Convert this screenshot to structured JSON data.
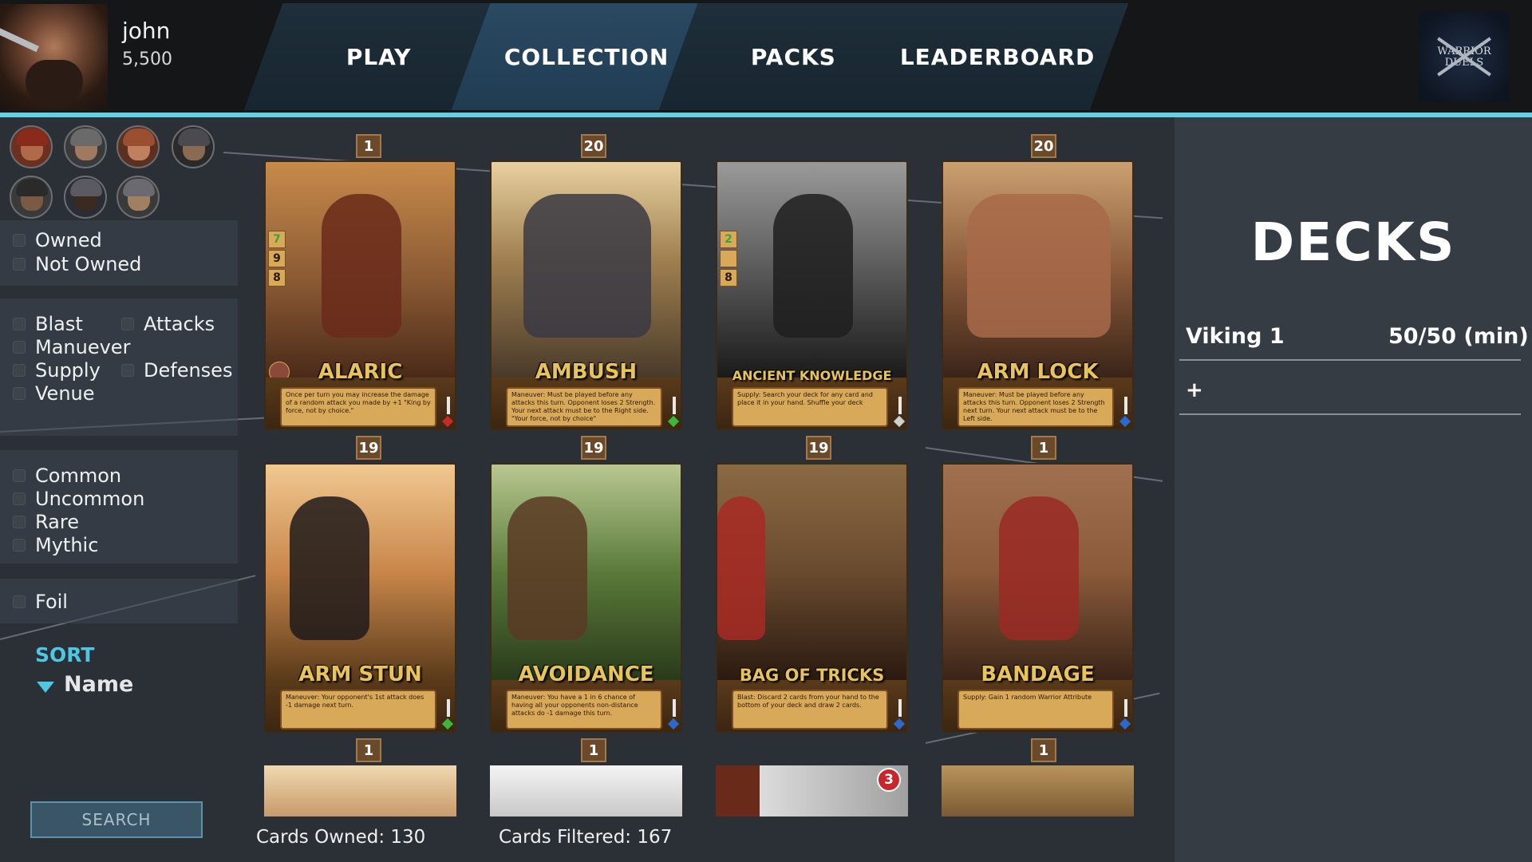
{
  "user": {
    "name": "john",
    "coins": "5,500"
  },
  "nav": {
    "tabs": [
      {
        "label": "PLAY",
        "active": false
      },
      {
        "label": "COLLECTION",
        "active": true
      },
      {
        "label": "PACKS",
        "active": false
      },
      {
        "label": "LEADERBOARD",
        "active": false
      }
    ],
    "logo_text": "WARRIOR DUELS"
  },
  "sidebar": {
    "ownership": [
      "Owned",
      "Not Owned"
    ],
    "types_left": [
      "Blast",
      "Manuever",
      "Supply",
      "Venue"
    ],
    "types_right": [
      "Attacks",
      "Defenses"
    ],
    "rarity": [
      "Common",
      "Uncommon",
      "Rare",
      "Mythic"
    ],
    "foil": "Foil",
    "sort_title": "SORT",
    "sort_value": "Name",
    "search_label": "SEARCH"
  },
  "cards": [
    {
      "count": "1",
      "name": "ALARIC",
      "desc": "Once per turn you may increase the damage of a random attack you made by +1     \"King by force, not by choice.\"",
      "stats": [
        "7",
        "9",
        "8"
      ],
      "gem": "#c82a2a",
      "art": "#8a5a34"
    },
    {
      "count": "20",
      "name": "AMBUSH",
      "desc": "Maneuver: Must be played before any attacks this turn. Opponent loses 2 Strength. Your next attack must be to the Right side. \"Your force, not by choice\"",
      "stats": [],
      "gem": "#3ab83a",
      "art": "#a08050"
    },
    {
      "count": "",
      "name": "ANCIENT KNOWLEDGE",
      "desc": "Supply: Search your deck for any card and place it in your hand. Shuffle your deck",
      "stats": [
        "2",
        "",
        "8"
      ],
      "gem": "#d0d0d0",
      "art": "#5a5a5a"
    },
    {
      "count": "20",
      "name": "ARM LOCK",
      "desc": "Maneuver: Must be played before any attacks this turn. Opponent loses 2 Strength next turn. Your next attack must be to the Left side.",
      "stats": [],
      "gem": "#2a6ad0",
      "art": "#7a5034"
    },
    {
      "count": "19",
      "name": "ARM STUN",
      "desc": "Maneuver: Your opponent's 1st attack does -1 damage next turn.",
      "stats": [],
      "gem": "#3ab83a",
      "art": "#c8864a"
    },
    {
      "count": "19",
      "name": "AVOIDANCE",
      "desc": "Maneuver: You have a 1 in 6 chance of having all your opponents non-distance attacks do -1 damage this turn.",
      "stats": [],
      "gem": "#2a6ad0",
      "art": "#5a7a3a"
    },
    {
      "count": "19",
      "name": "BAG OF TRICKS",
      "desc": "Blast: Discard 2 cards from your hand to the bottom of your deck and draw 2 cards.",
      "stats": [],
      "gem": "#2a6ad0",
      "art": "#6a4a2e"
    },
    {
      "count": "1",
      "name": "BANDAGE",
      "desc": "Supply: Gain 1 random Warrior Attribute",
      "stats": [],
      "gem": "#2a6ad0",
      "art": "#8a5a3a"
    }
  ],
  "partial_row": [
    {
      "count": "1"
    },
    {
      "count": "1"
    },
    {
      "badge": "3"
    },
    {
      "count": "1"
    }
  ],
  "footer": {
    "owned": "Cards Owned: 130",
    "filtered": "Cards Filtered: 167"
  },
  "decks": {
    "title": "DECKS",
    "items": [
      {
        "name": "Viking 1",
        "count": "50/50 (min)"
      }
    ],
    "add_label": "+"
  }
}
